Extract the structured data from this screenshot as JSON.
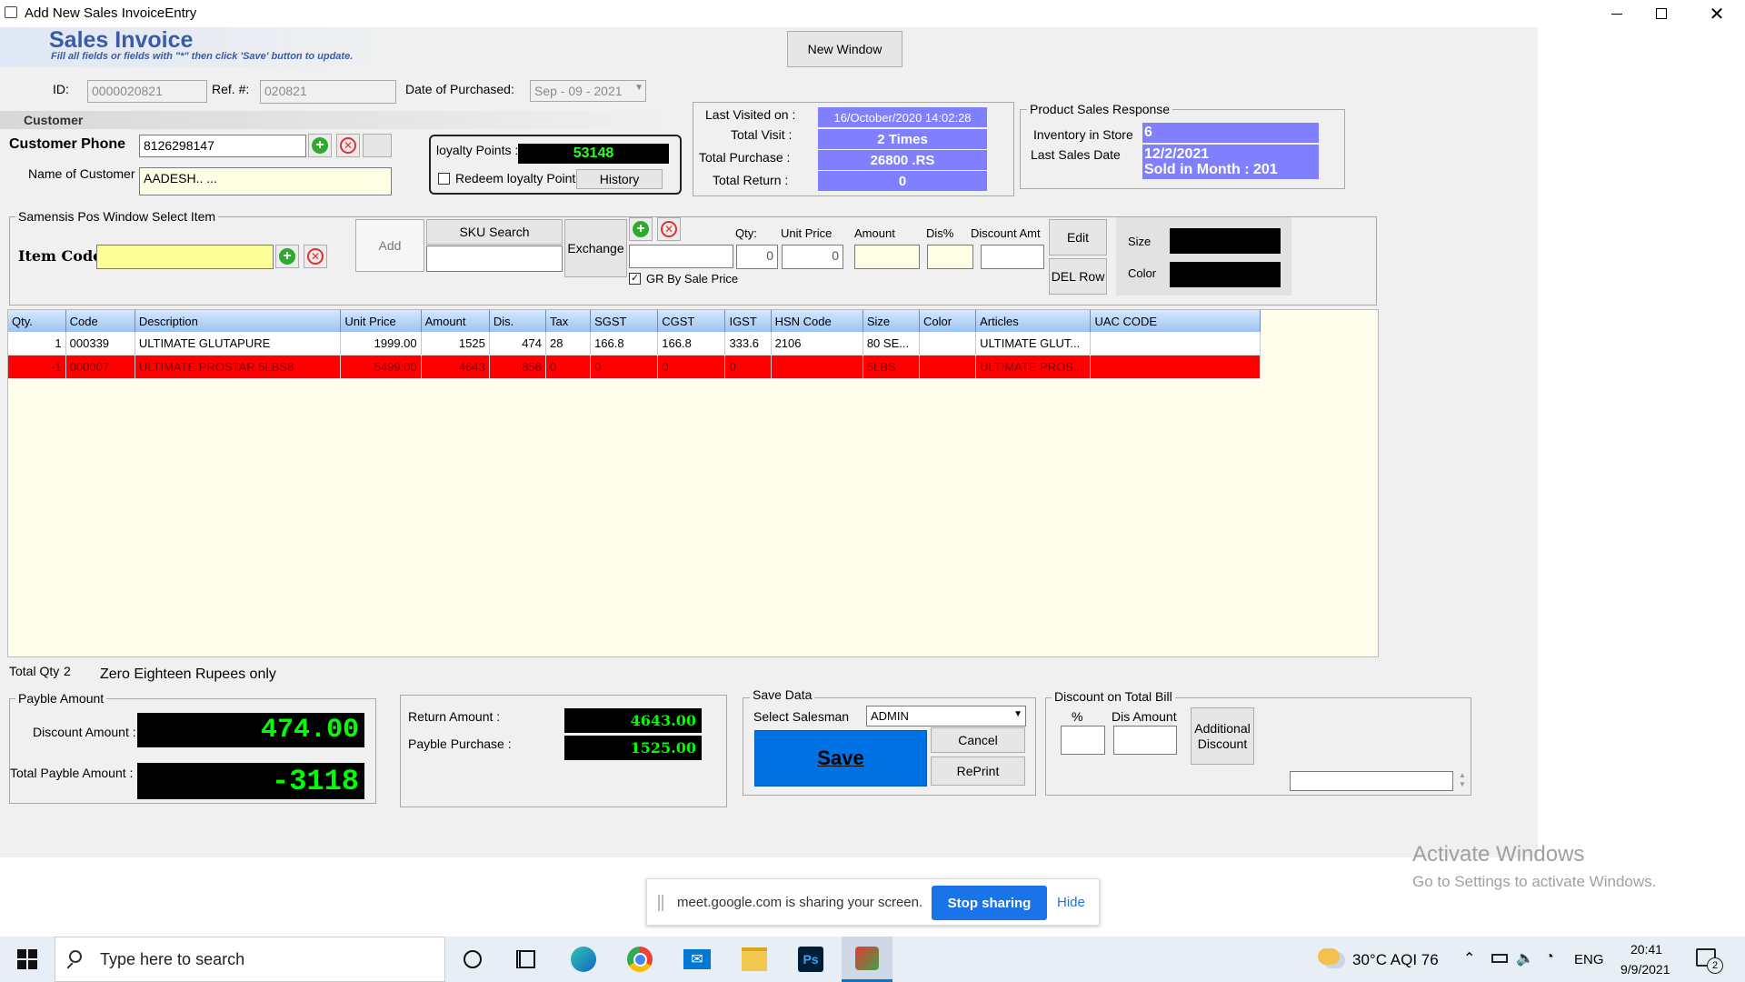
{
  "window": {
    "title": "Add New Sales InvoiceEntry"
  },
  "header": {
    "title": "Sales Invoice",
    "subtitle": "Fill all fields or fields with \"*\" then click 'Save' button to update.",
    "new_window_label": "New Window"
  },
  "ids": {
    "id_label": "ID:",
    "id_value": "0000020821",
    "ref_label": "Ref. #:",
    "ref_value": "020821",
    "date_label": "Date of Purchased:",
    "date_value": "Sep - 09 - 2021"
  },
  "customer": {
    "section_label": "Customer",
    "phone_label": "Customer Phone",
    "phone_value": "8126298147",
    "name_label": "Name of Customer",
    "name_value": "AADESH.. ..."
  },
  "loyalty": {
    "points_label": "loyalty Points :",
    "points_value": "53148",
    "redeem_label": "Redeem loyalty Point",
    "history_label": "History"
  },
  "visit": {
    "last_visited_label": "Last Visited on :",
    "last_visited_value": "16/October/2020 14:02:28",
    "total_visit_label": "Total Visit :",
    "total_visit_value": "2 Times",
    "total_purchase_label": "Total Purchase :",
    "total_purchase_value": "26800 .RS",
    "total_return_label": "Total Return :",
    "total_return_value": "0"
  },
  "product_response": {
    "title": "Product Sales Response",
    "inventory_label": "Inventory in Store",
    "inventory_value": "6",
    "last_sales_label": "Last Sales Date",
    "last_sales_value": "12/2/2021",
    "sold_month_value": "Sold in Month : 201"
  },
  "item_select": {
    "group_title": "Samensis Pos Window Select Item",
    "item_code_label": "Item Code",
    "add_label": "Add",
    "sku_search_label": "SKU Search",
    "exchange_label": "Exchange",
    "gr_label": "GR By Sale Price",
    "qty_label": "Qty:",
    "qty_value": "0",
    "unit_price_label": "Unit Price",
    "unit_price_value": "0",
    "amount_label": "Amount",
    "dis_label": "Dis%",
    "discount_amt_label": "Discount Amt",
    "edit_label": "Edit",
    "del_row_label": "DEL Row",
    "size_label": "Size",
    "color_label": "Color"
  },
  "grid": {
    "columns": [
      "Qty.",
      "Code",
      "Description",
      "Unit Price",
      "Amount",
      "Dis.",
      "Tax",
      "SGST",
      "CGST",
      "IGST",
      "HSN Code",
      "Size",
      "Color",
      "Articles",
      "UAC CODE"
    ],
    "rows": [
      [
        "1",
        "000339",
        "ULTIMATE GLUTAPURE",
        "1999.00",
        "1525",
        "474",
        "28",
        "166.8",
        "166.8",
        "333.6",
        "2106",
        "80 SE...",
        "",
        "ULTIMATE GLUT...",
        ""
      ],
      [
        "-1",
        "000007",
        "ULTIMATE PROSTAR 5LBS8",
        "5499.00",
        "4643",
        "856",
        "0",
        "0",
        "0",
        "0",
        "",
        "5LBS",
        "",
        "ULTIMATE PROS...",
        ""
      ]
    ]
  },
  "totals": {
    "total_qty_label": "Total Qty",
    "total_qty_value": "2",
    "in_words": "Zero Eighteen Rupees only"
  },
  "payable": {
    "group_title": "Payble Amount",
    "discount_label": "Discount Amount :",
    "discount_value": "474.00",
    "total_label": "Total  Payble Amount :",
    "total_value": "-3118"
  },
  "returns": {
    "return_label": "Return Amount :",
    "return_value": "4643.00",
    "payble_purchase_label": "Payble Purchase :",
    "payble_purchase_value": "1525.00"
  },
  "save": {
    "group_title": "Save Data",
    "salesman_label": "Select Salesman",
    "salesman_value": "ADMIN",
    "save_label": "Save",
    "cancel_label": "Cancel",
    "reprint_label": "RePrint"
  },
  "discount_bill": {
    "group_title": "Discount on Total Bill",
    "percent_label": "%",
    "dis_amount_label": "Dis Amount",
    "additional_label": "Additional Discount"
  },
  "activation": {
    "line1": "Activate Windows",
    "line2": "Go to Settings to activate Windows."
  },
  "share_bar": {
    "message": "meet.google.com is sharing your screen.",
    "stop_label": "Stop sharing",
    "hide_label": "Hide"
  },
  "taskbar": {
    "search_placeholder": "Type here to search",
    "weather": "30°C  AQI 76",
    "language": "ENG",
    "time": "20:41",
    "date": "9/9/2021",
    "notifications": "2"
  }
}
